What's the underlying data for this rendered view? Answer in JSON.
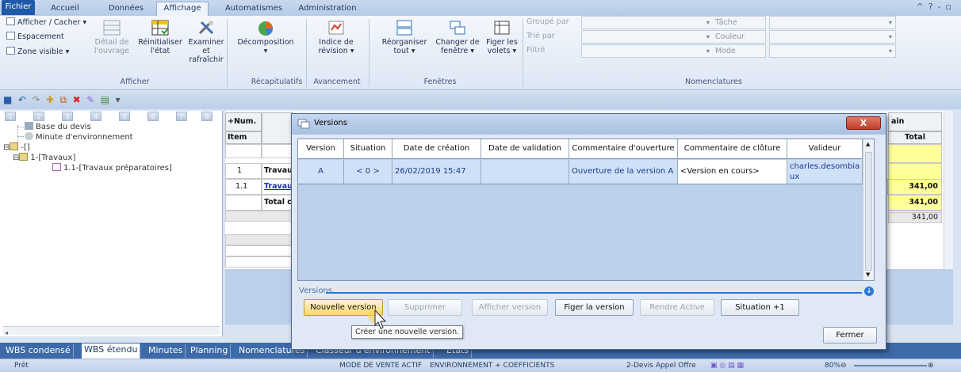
{
  "ribbon_tabs": [
    "Fichier",
    "Accueil",
    "Données",
    "Affichage",
    "Automatismes",
    "Administration"
  ],
  "ribbon": {
    "afficher_cacher": "Afficher / Cacher",
    "espacement": "Espacement",
    "zone_visible": "Zone visible",
    "detail_ouvrage": [
      "Détail de",
      "l'ouvrage"
    ],
    "reinitialiser": [
      "Réinitialiser",
      "l'état"
    ],
    "examiner": [
      "Examiner",
      "et rafraîchir"
    ],
    "group_afficher": "Afficher",
    "decomposition": "Décomposition",
    "group_recap": "Récapitulatifs",
    "indice": [
      "Indice de",
      "révision"
    ],
    "group_avancement": "Avancement",
    "reorganiser": [
      "Réorganiser",
      "tout"
    ],
    "changer": [
      "Changer de",
      "fenêtre"
    ],
    "figer": [
      "Figer les",
      "volets"
    ],
    "group_fenetres": "Fenêtres",
    "groupe_par": "Groupé par",
    "trie_par": "Trié par",
    "filtre": "Filtré",
    "tache": "Tâche",
    "couleur": "Couleur",
    "mode": "Mode",
    "group_nomenclatures": "Nomenclatures"
  },
  "tree": {
    "levels": [
      "1",
      "2",
      "3",
      "4",
      "5",
      "6",
      "7",
      "8"
    ],
    "items": [
      "Base du devis",
      "Minute d'environnement",
      "-[]",
      "1-[Travaux]",
      "1.1-[Travaux préparatoires]"
    ]
  },
  "grid": {
    "num_header": "+Num.",
    "item_header": "Item",
    "main_oeuvre_header": "ain d'oeuvre",
    "total_header": "Total",
    "rows": [
      {
        "num": "1",
        "label": "Travau",
        "total": "341,00"
      },
      {
        "num": "1.1",
        "label": "Travau",
        "total": "341,00"
      },
      {
        "num": "",
        "label": "Total c",
        "total": "341,00"
      }
    ],
    "footer_total": "341,00",
    "partial_value": "00"
  },
  "dialog": {
    "title": "Versions",
    "close_label": "X",
    "columns": [
      "Version",
      "Situation",
      "Date de création",
      "Date de validation",
      "Commentaire d'ouverture",
      "Commentaire de clôture",
      "Valideur"
    ],
    "row": {
      "version": "A",
      "situation": "< 0 >",
      "created": "26/02/2019 15:47",
      "validated": "",
      "open_comment": "Ouverture de la version A",
      "close_comment": "<Version en cours>",
      "validator": "charles.desombiaux"
    },
    "section_label": "Versions",
    "buttons": {
      "new": "Nouvelle version",
      "delete": "Supprimer",
      "show": "Afficher version",
      "freeze": "Figer la version",
      "activate": "Rendre Active",
      "situation": "Situation +1"
    },
    "tooltip": "Créer une nouvelle version.",
    "close_button": "Fermer"
  },
  "bottom_tabs": [
    "WBS condensé",
    "WBS étendu",
    "Minutes",
    "Planning",
    "Nomenclatures",
    "Classeur d'environnement",
    "Etats"
  ],
  "status": {
    "left": "Prêt",
    "mode": "MODE DE VENTE ACTIF",
    "env": "ENVIRONNEMENT + COEFFICIENTS",
    "doc": "2-Devis Appel Offre",
    "zoom": "80%"
  },
  "colors": {
    "accent": "#1f5aa8",
    "selected_row": "#cfe0f7",
    "highlight": "#ffff99",
    "close": "#c13d2c"
  }
}
